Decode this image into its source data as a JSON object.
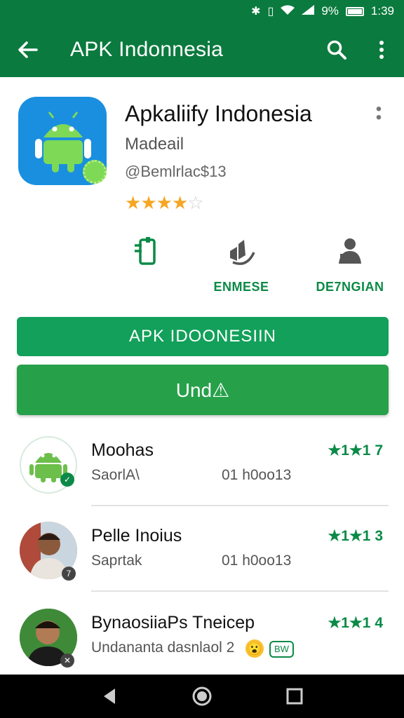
{
  "status_bar": {
    "percent": "9%",
    "time": "1:39"
  },
  "app_bar": {
    "title": "APK Indonnesia",
    "back_icon": "arrow-back-icon",
    "search_icon": "search-icon",
    "menu_icon": "more-vert-icon"
  },
  "app": {
    "name": "Apkaliify Indonesia",
    "developer": "Madeail",
    "handle": "@Bemlrlac$13",
    "rating_stars": 4,
    "rating_max": 5,
    "brand_color": "#1a8fe0"
  },
  "actions": [
    {
      "label": "",
      "icon": "phone-icon"
    },
    {
      "label": "ENMESE",
      "icon": "hand-icon"
    },
    {
      "label": "DE7NGIAN",
      "icon": "person-icon"
    }
  ],
  "buttons": {
    "primary": "APK IDOONESIIN",
    "secondary": "Und⚠"
  },
  "reviews": [
    {
      "name": "Moohas",
      "meta": "SaorlA\\",
      "date": "01 h0oo13",
      "rating": "★1★1 7"
    },
    {
      "name": "Pelle Inoius",
      "meta": "Saprtak",
      "date": "01 h0oo13",
      "rating": "★1★1 3"
    },
    {
      "name": "BynaosiiaPs Tneicep",
      "meta": "Undananta dasnlaol 2",
      "date": "",
      "rating": "★1★1 4",
      "tag": "BW"
    }
  ],
  "colors": {
    "accent": "#0b7a3e",
    "button": "#12a05a"
  }
}
